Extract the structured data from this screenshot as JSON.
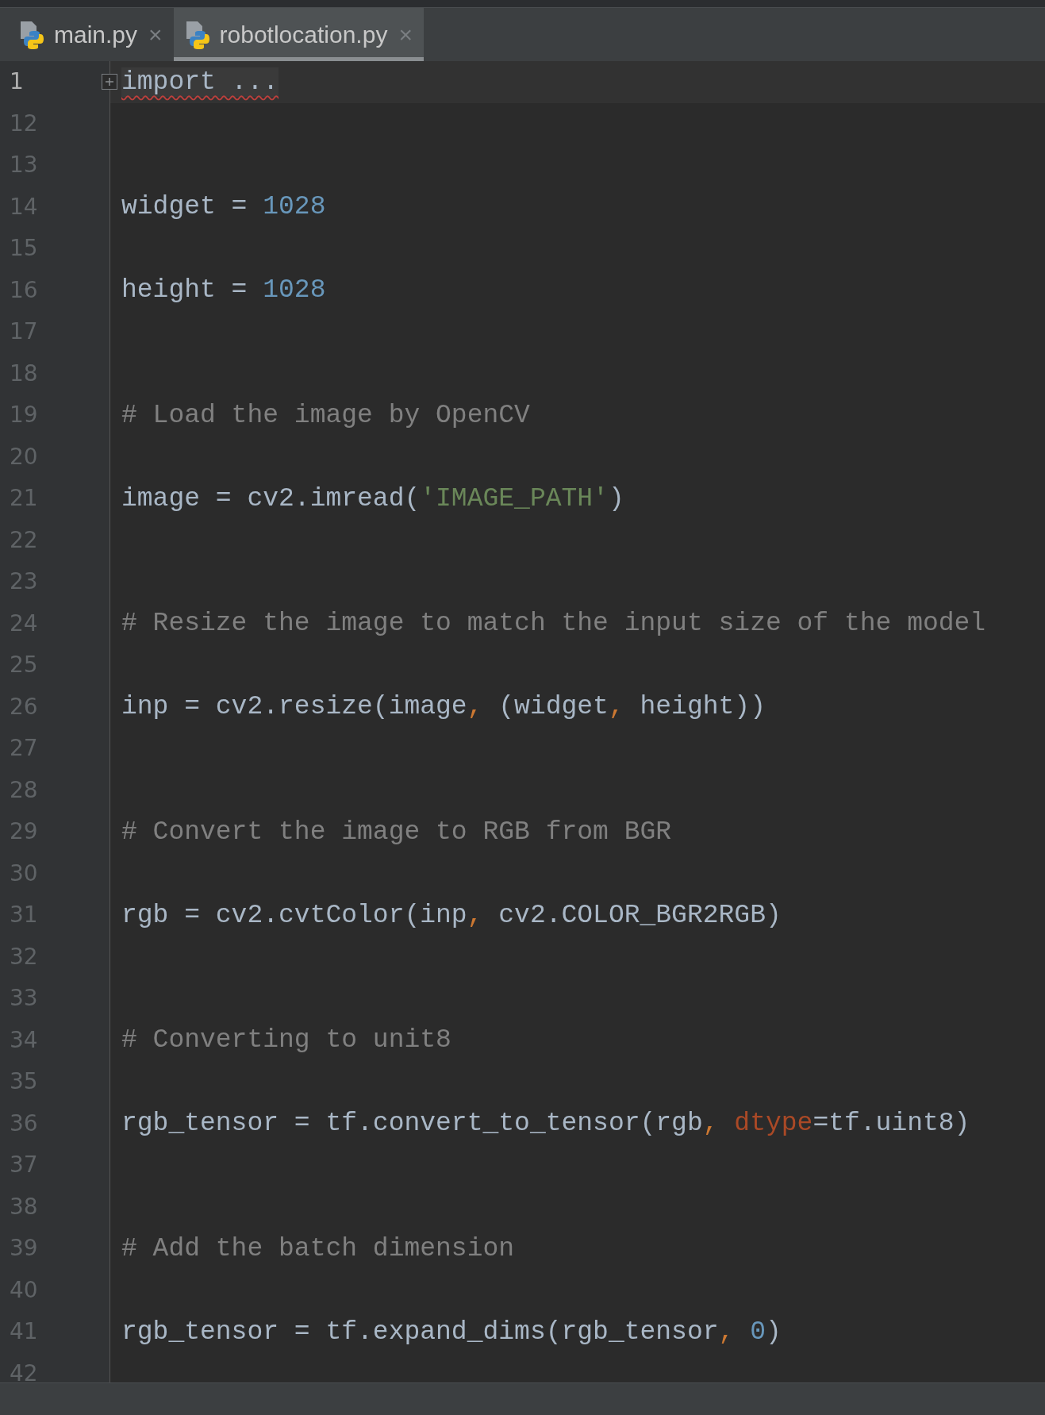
{
  "tabs": [
    {
      "label": "main.py",
      "close": "×",
      "selected": false
    },
    {
      "label": "robotlocation.py",
      "close": "×",
      "selected": true
    }
  ],
  "editor": {
    "lines": [
      {
        "number": "1",
        "current": true,
        "tokens": [
          {
            "kind": "folded",
            "text": "import ..."
          }
        ]
      },
      {
        "number": "12",
        "current": false
      },
      {
        "number": "13",
        "current": false
      },
      {
        "number": "14",
        "current": false,
        "tokens": [
          {
            "kind": "plain",
            "text": "widget = "
          },
          {
            "kind": "number",
            "text": "1028"
          }
        ]
      },
      {
        "number": "15",
        "current": false
      },
      {
        "number": "16",
        "current": false,
        "tokens": [
          {
            "kind": "plain",
            "text": "height = "
          },
          {
            "kind": "number",
            "text": "1028"
          }
        ]
      },
      {
        "number": "17",
        "current": false
      },
      {
        "number": "18",
        "current": false
      },
      {
        "number": "19",
        "current": false,
        "tokens": [
          {
            "kind": "comment",
            "text": "# Load the image by OpenCV"
          }
        ]
      },
      {
        "number": "20",
        "current": false
      },
      {
        "number": "21",
        "current": false,
        "tokens": [
          {
            "kind": "plain",
            "text": "image = cv2.imread("
          },
          {
            "kind": "string",
            "text": "'IMAGE_PATH'"
          },
          {
            "kind": "plain",
            "text": ")"
          }
        ]
      },
      {
        "number": "22",
        "current": false
      },
      {
        "number": "23",
        "current": false
      },
      {
        "number": "24",
        "current": false,
        "tokens": [
          {
            "kind": "comment",
            "text": "# Resize the image to match the input size of the model"
          }
        ]
      },
      {
        "number": "25",
        "current": false
      },
      {
        "number": "26",
        "current": false,
        "tokens": [
          {
            "kind": "plain",
            "text": "inp = cv2.resize(image"
          },
          {
            "kind": "comma",
            "text": ", "
          },
          {
            "kind": "plain",
            "text": "(widget"
          },
          {
            "kind": "comma",
            "text": ", "
          },
          {
            "kind": "plain",
            "text": "height))"
          }
        ]
      },
      {
        "number": "27",
        "current": false
      },
      {
        "number": "28",
        "current": false
      },
      {
        "number": "29",
        "current": false,
        "tokens": [
          {
            "kind": "comment",
            "text": "# Convert the image to RGB from BGR"
          }
        ]
      },
      {
        "number": "30",
        "current": false
      },
      {
        "number": "31",
        "current": false,
        "tokens": [
          {
            "kind": "plain",
            "text": "rgb = cv2.cvtColor(inp"
          },
          {
            "kind": "comma",
            "text": ", "
          },
          {
            "kind": "plain",
            "text": "cv2.COLOR_BGR2RGB)"
          }
        ]
      },
      {
        "number": "32",
        "current": false
      },
      {
        "number": "33",
        "current": false
      },
      {
        "number": "34",
        "current": false,
        "tokens": [
          {
            "kind": "comment",
            "text": "# Converting to unit8"
          }
        ]
      },
      {
        "number": "35",
        "current": false
      },
      {
        "number": "36",
        "current": false,
        "tokens": [
          {
            "kind": "plain",
            "text": "rgb_tensor = tf.convert_to_tensor(rgb"
          },
          {
            "kind": "comma",
            "text": ", "
          },
          {
            "kind": "param",
            "text": "dtype"
          },
          {
            "kind": "plain",
            "text": "=tf.uint8)"
          }
        ]
      },
      {
        "number": "37",
        "current": false
      },
      {
        "number": "38",
        "current": false
      },
      {
        "number": "39",
        "current": false,
        "tokens": [
          {
            "kind": "comment",
            "text": "# Add the batch dimension"
          }
        ]
      },
      {
        "number": "40",
        "current": false
      },
      {
        "number": "41",
        "current": false,
        "tokens": [
          {
            "kind": "plain",
            "text": "rgb_tensor = tf.expand_dims(rgb_tensor"
          },
          {
            "kind": "comma",
            "text": ", "
          },
          {
            "kind": "number",
            "text": "0"
          },
          {
            "kind": "plain",
            "text": ")"
          }
        ]
      },
      {
        "number": "42",
        "current": false
      }
    ]
  }
}
